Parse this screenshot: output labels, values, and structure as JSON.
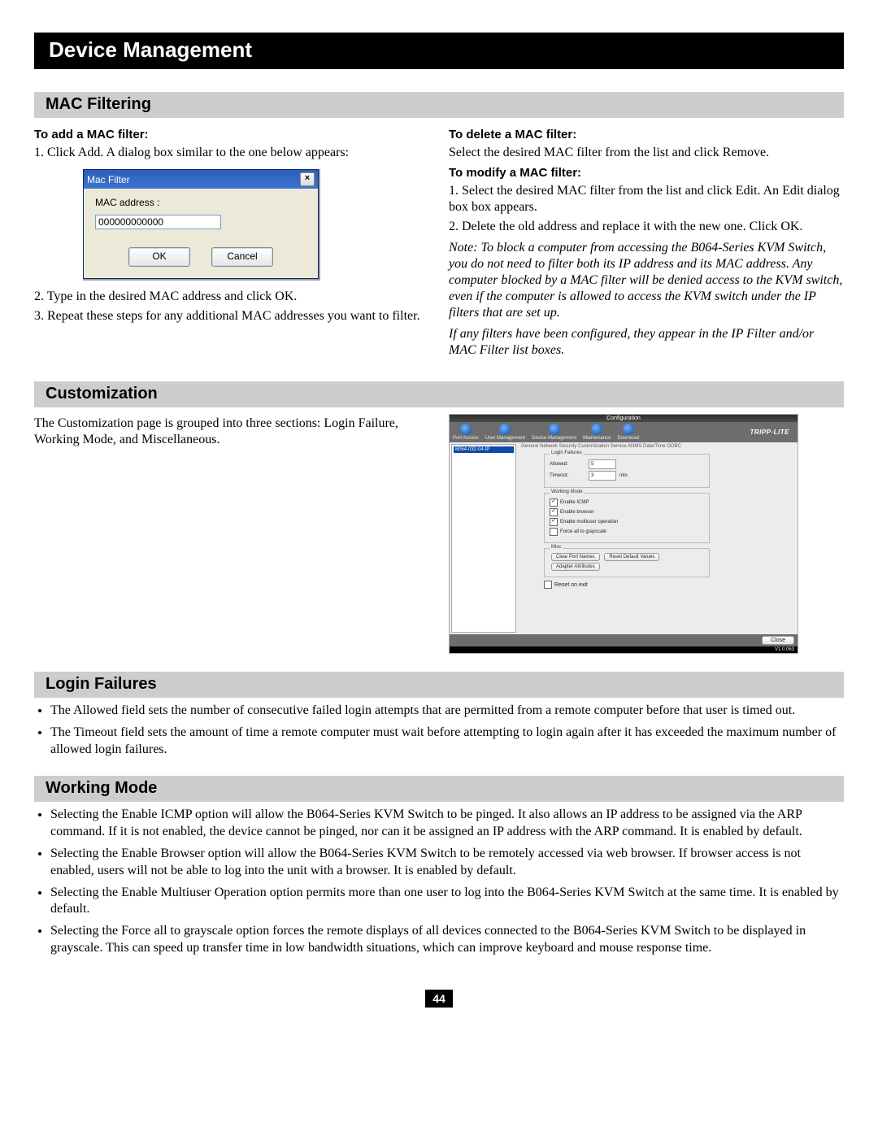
{
  "page_title": "Device Management",
  "sections": {
    "mac_filtering": {
      "title": "MAC Filtering"
    },
    "customization": {
      "title": "Customization"
    },
    "login_failures": {
      "title": "Login Failures"
    },
    "working_mode": {
      "title": "Working Mode"
    }
  },
  "mac": {
    "add_head": "To add a MAC filter:",
    "step1": "1. Click Add. A dialog box similar to the one below appears:",
    "step2": "2. Type in the desired MAC address and click OK.",
    "step3": "3. Repeat these steps for any additional MAC addresses you want to filter.",
    "delete_head": "To delete a MAC filter:",
    "delete_body": "Select the desired MAC filter from the list and click Remove.",
    "modify_head": "To modify a MAC filter:",
    "modify_step1": "1. Select the desired MAC filter from the list and click Edit. An Edit dialog box box appears.",
    "modify_step2": "2. Delete the old address and replace it with the new one. Click OK.",
    "note1": "Note: To block a computer from accessing the B064-Series KVM Switch, you do not need to filter both its IP address and its MAC address. Any computer blocked by a MAC filter will be denied access to the KVM switch, even if the computer is allowed to access the KVM switch under the IP filters that are set up.",
    "note2": "If any filters have been configured, they appear in the IP Filter and/or MAC Filter list boxes."
  },
  "dlg": {
    "title": "Mac Filter",
    "label": "MAC address :",
    "value": "000000000000",
    "ok": "OK",
    "cancel": "Cancel"
  },
  "cust": {
    "intro": "The Customization page is grouped into three sections: Login Failure, Working Mode, and Miscellaneous."
  },
  "cfg": {
    "banner": "Configuration",
    "nav": {
      "port": "Port Access",
      "user": "User Management",
      "device": "Device Management",
      "maint": "Maintenance",
      "download": "Download"
    },
    "logo": "TRIPP·LITE",
    "tree_item": "B064-032-04-IP",
    "tabs": "General  Network  Security  Customization  Service  ANMS  Date/Time  OOBC",
    "tab_active": "Customization",
    "group_login": "Login Failures",
    "allowed_lbl": "Allowed:",
    "allowed_val": "5",
    "timeout_lbl": "Timeout:",
    "timeout_val": "3",
    "timeout_unit": "min",
    "group_working": "Working Mode",
    "enable_icmp": "Enable ICMP",
    "enable_browser": "Enable browser",
    "enable_multiuser": "Enable multiuser operation",
    "force_gray": "Force all to grayscale",
    "group_misc": "Misc",
    "clear_port": "Clear Port Names",
    "reset_default": "Reset Default Values",
    "adapter_attr": "Adapter Attributes",
    "reset_exit": "Reset on exit",
    "close_btn": "Close",
    "version": "V1.0.063"
  },
  "lf": {
    "b1": "The Allowed field sets the number of consecutive failed login attempts that are permitted from a remote computer before that user is timed out.",
    "b2": "The Timeout field sets the amount of time a remote computer must wait before attempting to login again after it has exceeded the maximum number of allowed login failures."
  },
  "wm": {
    "b1": "Selecting the Enable ICMP option will allow the B064-Series KVM Switch to be pinged. It also allows an IP address to be assigned via the ARP command. If it is not enabled, the device cannot be pinged, nor can it be assigned an IP address with the ARP command. It is enabled by default.",
    "b2": "Selecting the Enable Browser option will allow the B064-Series KVM Switch to be remotely accessed via web browser. If browser access is not enabled, users will not be able to log into the unit with a browser. It is enabled by default.",
    "b3": "Selecting the Enable Multiuser Operation option permits more than one user to log into the B064-Series KVM Switch at the same time. It is enabled by default.",
    "b4": "Selecting the Force all to grayscale option forces the remote displays of all devices connected to the B064-Series KVM Switch to be displayed in grayscale. This can speed up transfer time in low bandwidth situations, which can improve keyboard and mouse response time."
  },
  "page_number": "44"
}
